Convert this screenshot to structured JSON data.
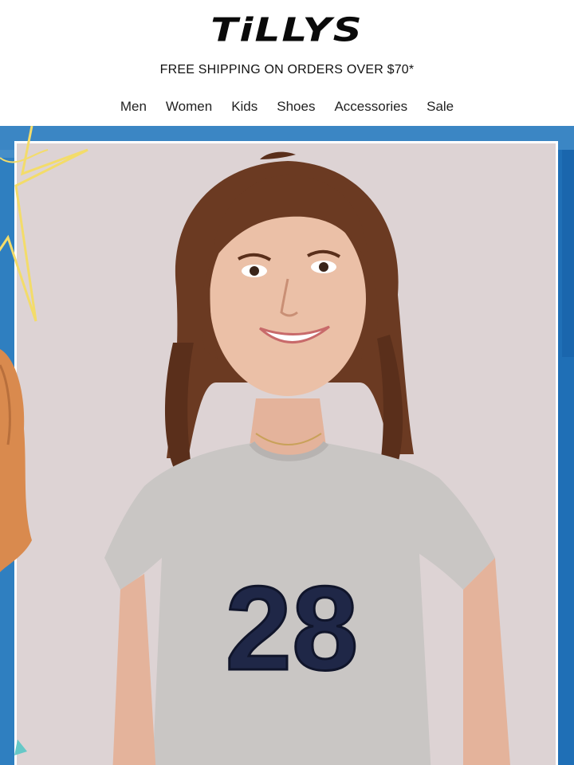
{
  "header": {
    "logo_text": "TiLLYS",
    "promo": "FREE SHIPPING ON ORDERS OVER $70*"
  },
  "nav": {
    "items": [
      {
        "label": "Men"
      },
      {
        "label": "Women"
      },
      {
        "label": "Kids"
      },
      {
        "label": "Shoes"
      },
      {
        "label": "Accessories"
      },
      {
        "label": "Sale"
      }
    ]
  },
  "hero": {
    "shirt_number": "28"
  },
  "colors": {
    "background_blue": "#2f7fc0",
    "photo_backdrop": "#ddd3d4",
    "shirt_gray": "#c9c6c4",
    "number_navy": "#1f2747",
    "star_yellow": "#f3dc6a",
    "orange_paint": "#d98a4e"
  }
}
